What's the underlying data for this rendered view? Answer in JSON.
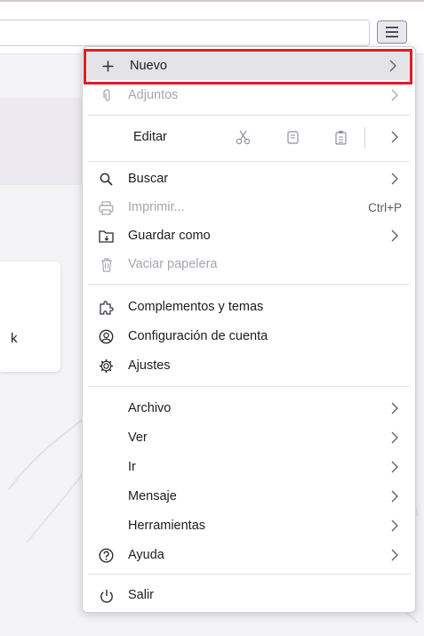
{
  "menu": {
    "new": {
      "label": "Nuevo",
      "icon": "plus-icon"
    },
    "attachments": {
      "label": "Adjuntos",
      "icon": "paperclip-icon"
    },
    "edit": {
      "label": "Editar",
      "cut_icon": "scissors-icon",
      "copy_icon": "copy-icon",
      "paste_icon": "paste-icon"
    },
    "find": {
      "label": "Buscar",
      "icon": "search-icon"
    },
    "print": {
      "label": "Imprimir...",
      "accel": "Ctrl+P",
      "icon": "printer-icon"
    },
    "save_as": {
      "label": "Guardar como",
      "icon": "folder-save-icon"
    },
    "empty_trash": {
      "label": "Vaciar papelera",
      "icon": "trash-icon"
    },
    "addons": {
      "label": "Complementos y temas",
      "icon": "puzzle-icon"
    },
    "account_settings": {
      "label": "Configuración de cuenta",
      "icon": "account-icon"
    },
    "settings": {
      "label": "Ajustes",
      "icon": "gear-icon"
    },
    "file": {
      "label": "Archivo"
    },
    "view": {
      "label": "Ver"
    },
    "go": {
      "label": "Ir"
    },
    "message": {
      "label": "Mensaje"
    },
    "tools": {
      "label": "Herramientas"
    },
    "help": {
      "label": "Ayuda",
      "icon": "help-icon"
    },
    "quit": {
      "label": "Salir",
      "icon": "power-icon"
    }
  },
  "background": {
    "card_text": "k"
  },
  "colors": {
    "highlight_frame": "#e41b23",
    "hover_bg": "#e4e4e8",
    "menu_bg": "#ffffff"
  }
}
